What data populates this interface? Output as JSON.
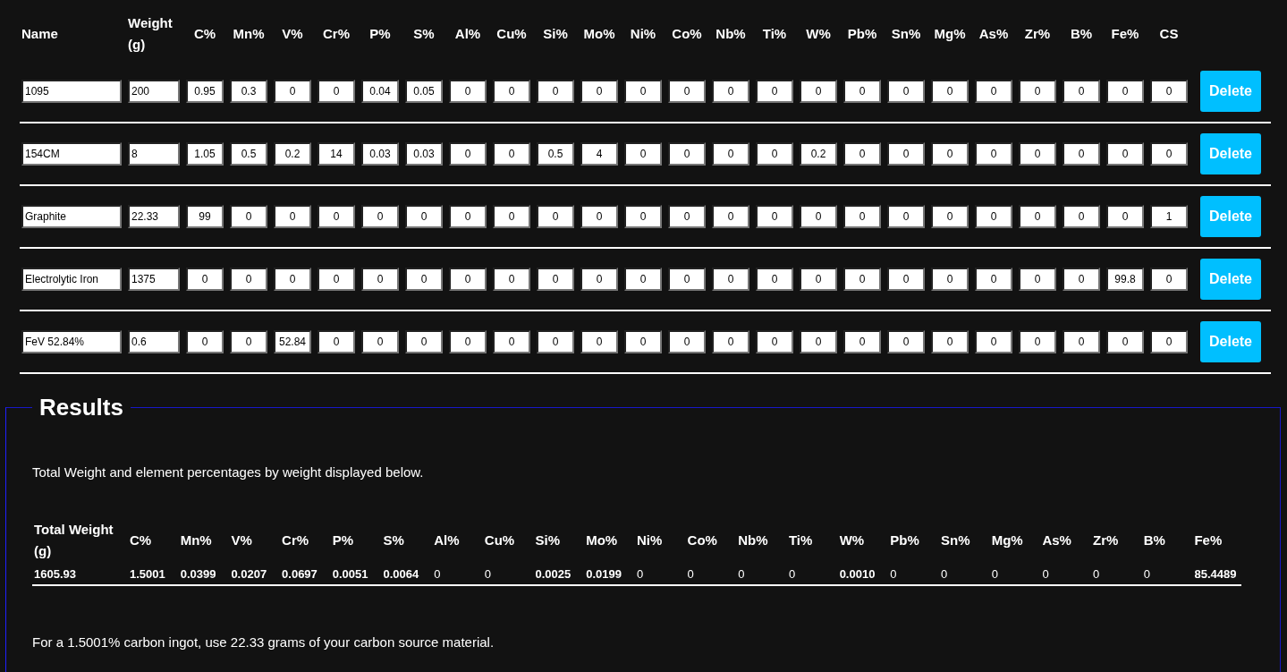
{
  "columns": [
    "Name",
    "Weight (g)",
    "C%",
    "Mn%",
    "V%",
    "Cr%",
    "P%",
    "S%",
    "Al%",
    "Cu%",
    "Si%",
    "Mo%",
    "Ni%",
    "Co%",
    "Nb%",
    "Ti%",
    "W%",
    "Pb%",
    "Sn%",
    "Mg%",
    "As%",
    "Zr%",
    "B%",
    "Fe%",
    "CS"
  ],
  "rows": [
    {
      "name": "1095",
      "weight": "200",
      "values": [
        "0.95",
        "0.3",
        "0",
        "0",
        "0.04",
        "0.05",
        "0",
        "0",
        "0",
        "0",
        "0",
        "0",
        "0",
        "0",
        "0",
        "0",
        "0",
        "0",
        "0",
        "0",
        "0",
        "0",
        "0"
      ],
      "button": "Delete"
    },
    {
      "name": "154CM",
      "weight": "8",
      "values": [
        "1.05",
        "0.5",
        "0.2",
        "14",
        "0.03",
        "0.03",
        "0",
        "0",
        "0.5",
        "4",
        "0",
        "0",
        "0",
        "0",
        "0.2",
        "0",
        "0",
        "0",
        "0",
        "0",
        "0",
        "0",
        "0"
      ],
      "button": "Delete"
    },
    {
      "name": "Graphite",
      "weight": "22.33",
      "values": [
        "99",
        "0",
        "0",
        "0",
        "0",
        "0",
        "0",
        "0",
        "0",
        "0",
        "0",
        "0",
        "0",
        "0",
        "0",
        "0",
        "0",
        "0",
        "0",
        "0",
        "0",
        "0",
        "1"
      ],
      "button": "Delete"
    },
    {
      "name": "Electrolytic Iron",
      "weight": "1375",
      "values": [
        "0",
        "0",
        "0",
        "0",
        "0",
        "0",
        "0",
        "0",
        "0",
        "0",
        "0",
        "0",
        "0",
        "0",
        "0",
        "0",
        "0",
        "0",
        "0",
        "0",
        "0",
        "99.8",
        "0"
      ],
      "button": "Delete"
    },
    {
      "name": "FeV 52.84%",
      "weight": "0.6",
      "values": [
        "0",
        "0",
        "52.84",
        "0",
        "0",
        "0",
        "0",
        "0",
        "0",
        "0",
        "0",
        "0",
        "0",
        "0",
        "0",
        "0",
        "0",
        "0",
        "0",
        "0",
        "0",
        "0",
        "0"
      ],
      "button": "Delete"
    }
  ],
  "results": {
    "title": "Results",
    "intro": "Total Weight and element percentages by weight displayed below.",
    "columns": [
      "Total Weight (g)",
      "C%",
      "Mn%",
      "V%",
      "Cr%",
      "P%",
      "S%",
      "Al%",
      "Cu%",
      "Si%",
      "Mo%",
      "Ni%",
      "Co%",
      "Nb%",
      "Ti%",
      "W%",
      "Pb%",
      "Sn%",
      "Mg%",
      "As%",
      "Zr%",
      "B%",
      "Fe%"
    ],
    "values": [
      {
        "text": "1605.93",
        "bold": true
      },
      {
        "text": "1.5001",
        "bold": true
      },
      {
        "text": "0.0399",
        "bold": true
      },
      {
        "text": "0.0207",
        "bold": true
      },
      {
        "text": "0.0697",
        "bold": true
      },
      {
        "text": "0.0051",
        "bold": true
      },
      {
        "text": "0.0064",
        "bold": true
      },
      {
        "text": "0",
        "bold": false
      },
      {
        "text": "0",
        "bold": false
      },
      {
        "text": "0.0025",
        "bold": true
      },
      {
        "text": "0.0199",
        "bold": true
      },
      {
        "text": "0",
        "bold": false
      },
      {
        "text": "0",
        "bold": false
      },
      {
        "text": "0",
        "bold": false
      },
      {
        "text": "0",
        "bold": false
      },
      {
        "text": "0.0010",
        "bold": true
      },
      {
        "text": "0",
        "bold": false
      },
      {
        "text": "0",
        "bold": false
      },
      {
        "text": "0",
        "bold": false
      },
      {
        "text": "0",
        "bold": false
      },
      {
        "text": "0",
        "bold": false
      },
      {
        "text": "0",
        "bold": false
      },
      {
        "text": "85.4489",
        "bold": true
      }
    ],
    "note": "For a 1.5001% carbon ingot, use 22.33 grams of your carbon source material."
  }
}
